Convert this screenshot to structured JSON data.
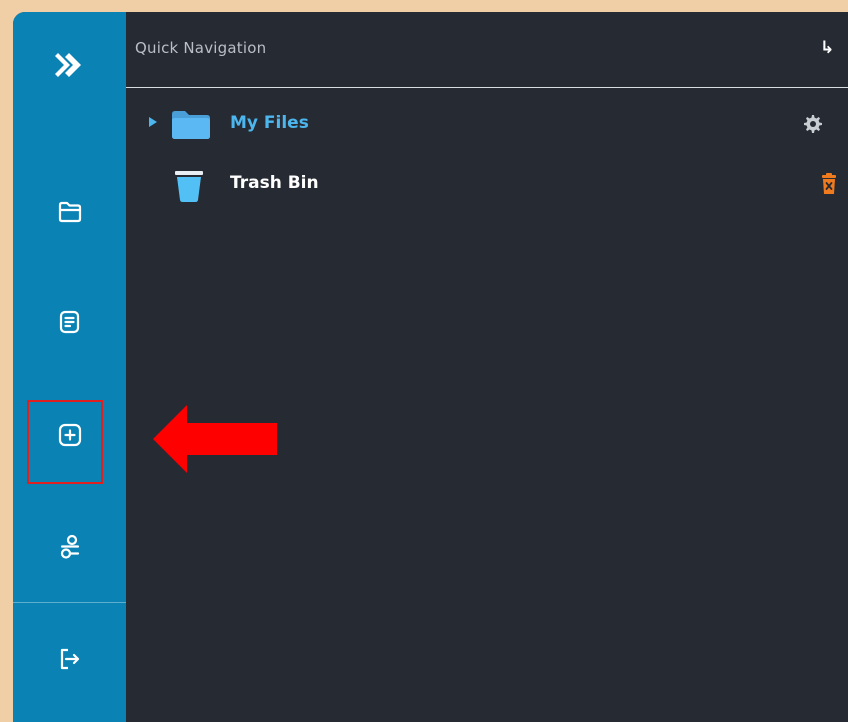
{
  "sidebar": {
    "items": [
      {
        "name": "logo",
        "icon": "chevron-double-right-icon"
      },
      {
        "name": "files",
        "icon": "folder-icon"
      },
      {
        "name": "documents",
        "icon": "document-icon"
      },
      {
        "name": "add-new",
        "icon": "plus-square-icon"
      },
      {
        "name": "workflows",
        "icon": "workflow-icon"
      },
      {
        "name": "logout",
        "icon": "logout-icon"
      }
    ]
  },
  "panel": {
    "title": "Quick Navigation",
    "collapse_icon": "↳",
    "tree": [
      {
        "label": "My Files",
        "icon": "folder-icon",
        "action_icon": "gear-icon",
        "expandable": true
      },
      {
        "label": "Trash Bin",
        "icon": "trash-bin-icon",
        "action_icon": "delete-icon",
        "expandable": false
      }
    ]
  },
  "annotation": {
    "type": "arrow",
    "color": "#ff0000",
    "highlight_color": "#e02020"
  },
  "colors": {
    "sidebar": "#0a83b4",
    "panel": "#262a33",
    "accent": "#4cb6ee",
    "delete": "#f07b1e",
    "frame": "#f0cfa6"
  }
}
